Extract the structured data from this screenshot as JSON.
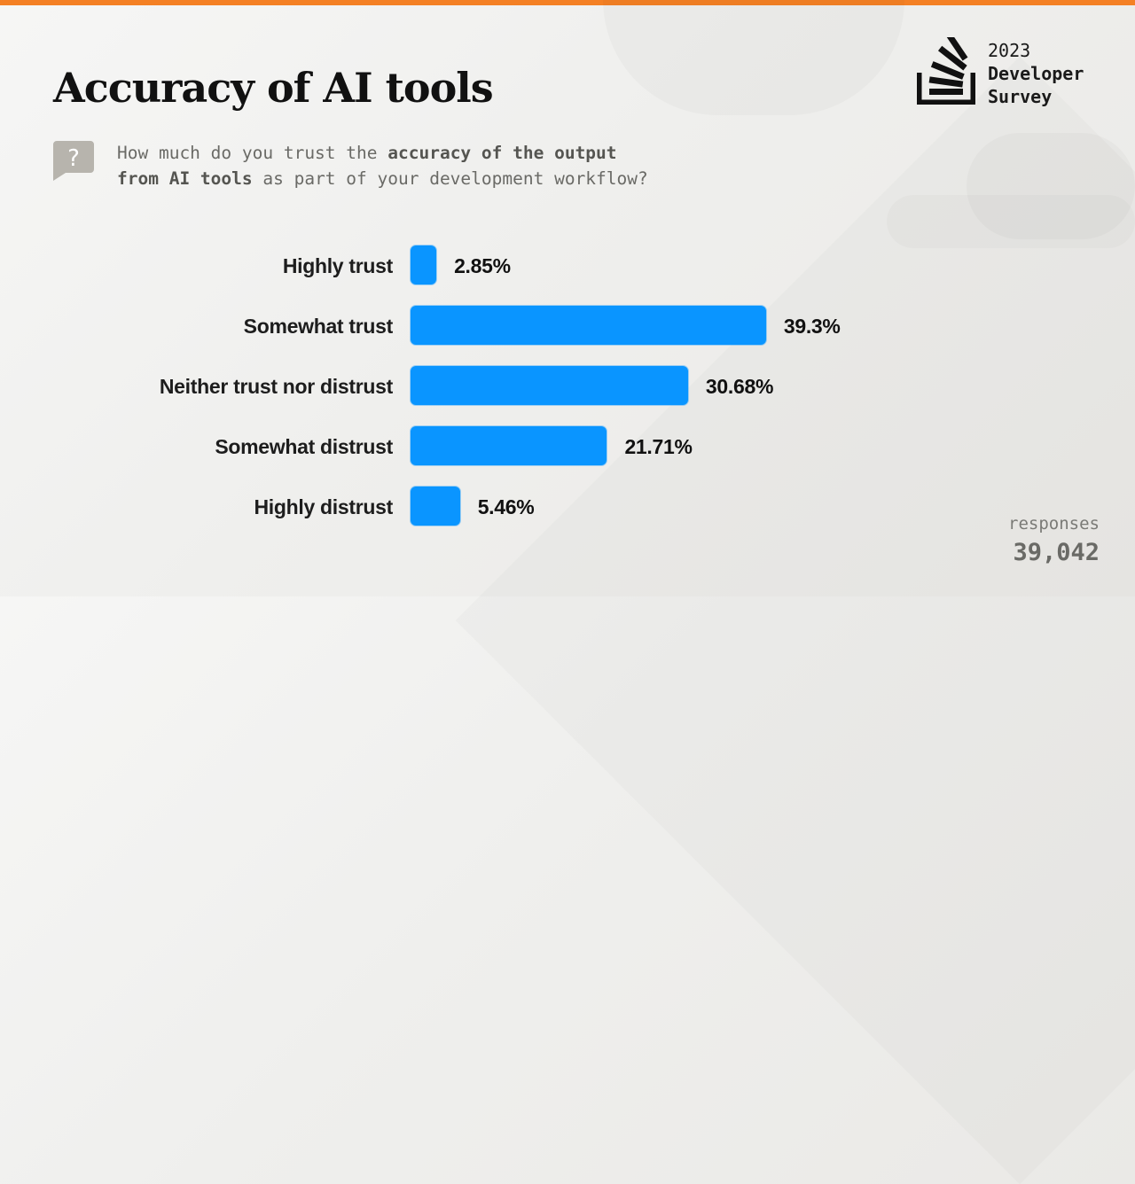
{
  "header": {
    "title": "Accuracy of AI tools",
    "question_parts": [
      {
        "text": "How much do you trust the ",
        "bold": false
      },
      {
        "text": "accuracy of the output",
        "bold": true
      },
      {
        "text": "\n",
        "bold": false
      },
      {
        "text": "from AI tools",
        "bold": true
      },
      {
        "text": " as part of your development workflow?",
        "bold": false
      }
    ],
    "question_icon": "question-bubble-icon"
  },
  "brand": {
    "year": "2023",
    "line1": "Developer",
    "line2": "Survey",
    "logo_icon": "stack-overflow-logo-icon",
    "accent_color": "#f48024"
  },
  "footer": {
    "responses_label": "responses",
    "responses_count": "39,042"
  },
  "colors": {
    "bar": "#0a95ff",
    "top_bar": "#f48024"
  },
  "chart_data": {
    "type": "bar",
    "orientation": "horizontal",
    "title": "Accuracy of AI tools",
    "xlabel": "",
    "ylabel": "",
    "unit": "%",
    "grid": false,
    "legend": "none",
    "categories": [
      "Highly trust",
      "Somewhat trust",
      "Neither trust nor distrust",
      "Somewhat distrust",
      "Highly distrust"
    ],
    "values": [
      2.85,
      39.3,
      30.68,
      21.71,
      5.46
    ],
    "value_labels": [
      "2.85%",
      "39.3%",
      "30.68%",
      "21.71%",
      "5.46%"
    ],
    "xlim": [
      0,
      100
    ]
  }
}
